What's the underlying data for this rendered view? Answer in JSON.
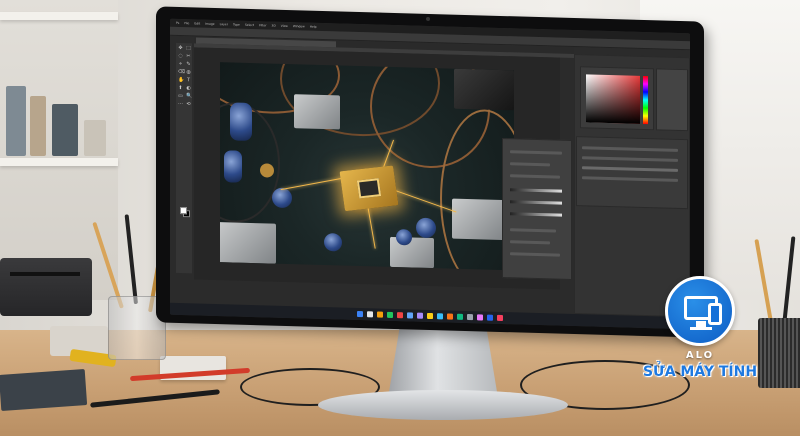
{
  "photoshop": {
    "menu": [
      "Ps",
      "File",
      "Edit",
      "Image",
      "Layer",
      "Type",
      "Select",
      "Filter",
      "3D",
      "View",
      "Window",
      "Help"
    ],
    "tools": [
      "✥",
      "⬚",
      "◌",
      "✂",
      "⌖",
      "✎",
      "⌫",
      "◍",
      "✋",
      "T",
      "⬆",
      "◐",
      "▭",
      "🔍",
      "⋯",
      "⟲"
    ]
  },
  "taskbar": {
    "icons": [
      "#3b82f6",
      "#e5e7eb",
      "#f59e0b",
      "#22c55e",
      "#ef4444",
      "#60a5fa",
      "#a78bfa",
      "#facc15",
      "#38bdf8",
      "#f97316",
      "#10b981",
      "#9ca3af",
      "#e879f9",
      "#2563eb",
      "#f43f5e"
    ]
  },
  "logo": {
    "top_text": "ALO",
    "brand_text": "SỬA MÁY TÍNH",
    "brand_color": "#1e79e0"
  }
}
